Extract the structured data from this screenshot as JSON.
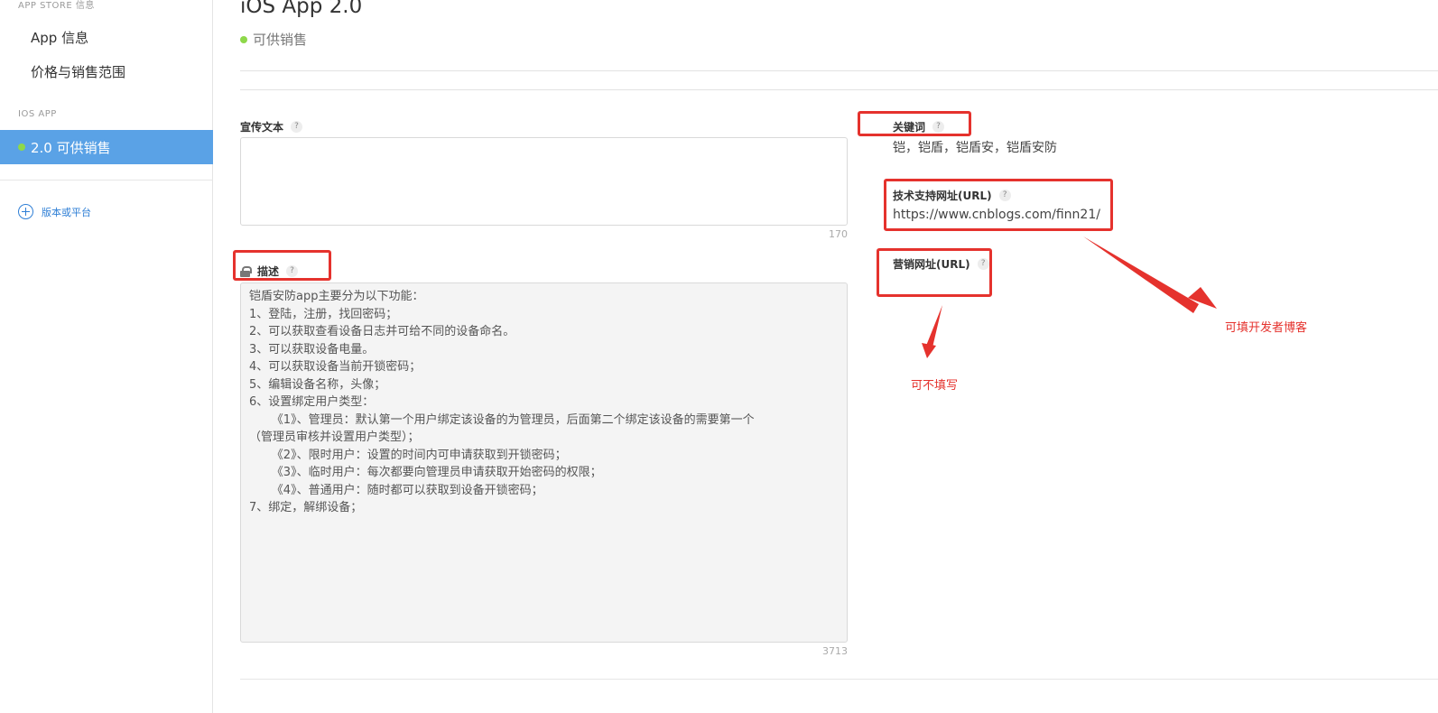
{
  "sidebar": {
    "section_appstore": "APP STORE 信息",
    "item_app_info": "App 信息",
    "item_pricing": "价格与销售范围",
    "section_ios": "IOS APP",
    "active_item": "2.0 可供销售",
    "add_version": "版本或平台"
  },
  "header": {
    "title": "iOS App 2.0",
    "status": "可供销售"
  },
  "form": {
    "promo_label": "宣传文本",
    "promo_value": "",
    "promo_counter": "170",
    "desc_label": "描述",
    "desc_counter": "3713",
    "description_lines": [
      "铠盾安防app主要分为以下功能：",
      "1、登陆，注册，找回密码；",
      "2、可以获取查看设备日志并可给不同的设备命名。",
      "3、可以获取设备电量。",
      "4、可以获取设备当前开锁密码；",
      "5、编辑设备名称，头像；",
      "6、设置绑定用户类型：",
      "      《1》、管理员：默认第一个用户绑定该设备的为管理员，后面第二个绑定该设备的需要第一个",
      "（管理员审核并设置用户类型）；",
      "      《2》、限时用户：设置的时间内可申请获取到开锁密码；",
      "      《3》、临时用户：每次都要向管理员申请获取开始密码的权限；",
      "      《4》、普通用户：随时都可以获取到设备开锁密码；",
      "7、绑定，解绑设备；"
    ],
    "keywords_label": "关键词",
    "keywords_value": "铠，铠盾，铠盾安，铠盾安防",
    "support_url_label": "技术支持网址(URL)",
    "support_url_value": "https://www.cnblogs.com/finn21/",
    "marketing_url_label": "营销网址(URL)",
    "marketing_url_value": "",
    "help_mark": "?"
  },
  "annotations": {
    "note_optional": "可不填写",
    "note_blog": "可填开发者博客",
    "color": "#e5322d"
  },
  "colors": {
    "sidebar_active": "#5aa2e6",
    "status_dot": "#8ed84a",
    "link": "#2f7fd6"
  }
}
